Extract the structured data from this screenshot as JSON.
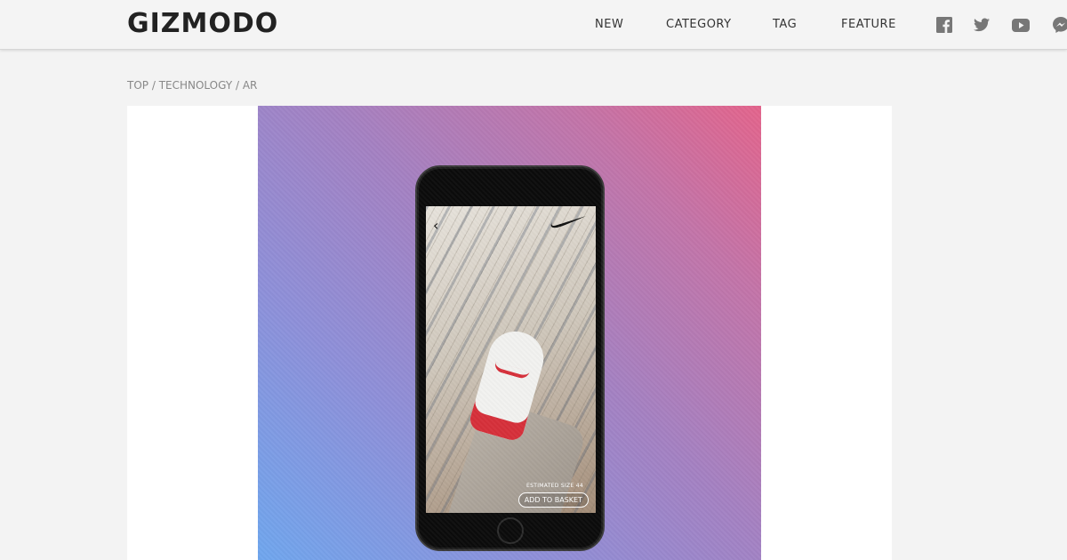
{
  "header": {
    "logo": "GIZMODO",
    "nav": [
      {
        "label": "NEW"
      },
      {
        "label": "CATEGORY"
      },
      {
        "label": "TAG"
      },
      {
        "label": "FEATURE"
      }
    ],
    "social_icons": [
      "facebook-icon",
      "twitter-icon",
      "youtube-icon",
      "messenger-icon"
    ]
  },
  "breadcrumb": {
    "items": [
      "TOP",
      "TECHNOLOGY",
      "AR"
    ],
    "separator": " / "
  },
  "hero": {
    "screen": {
      "back": "‹",
      "size_label": "ESTIMATED SIZE 44",
      "basket_button": "ADD TO BASKET"
    }
  },
  "colors": {
    "background": "#f3f3f3",
    "header_bg": "#f4f4f4",
    "icon_gray": "#777777",
    "gradient_start": "#6fa6ee",
    "gradient_end": "#e3648c",
    "shoe_accent": "#d6303a"
  }
}
